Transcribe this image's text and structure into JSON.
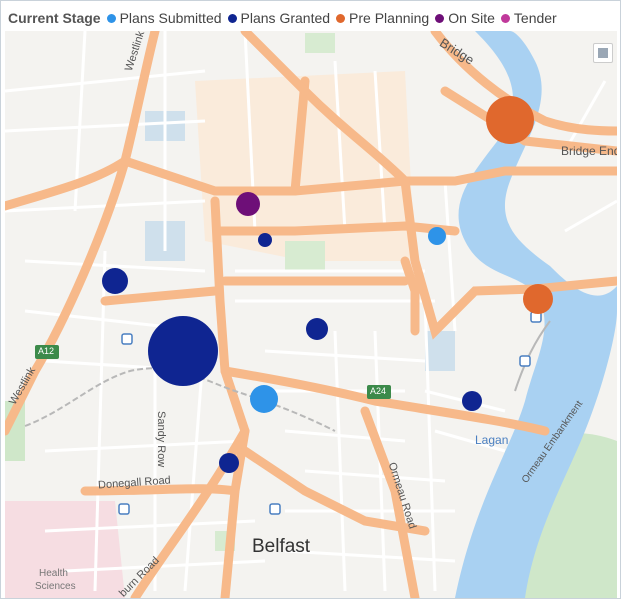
{
  "legend": {
    "title": "Current Stage",
    "entries": [
      {
        "label": "Plans Submitted",
        "color": "#2e93e8"
      },
      {
        "label": "Plans Granted",
        "color": "#0f2591"
      },
      {
        "label": "Pre Planning",
        "color": "#e0682d"
      },
      {
        "label": "On Site",
        "color": "#6e0f78"
      },
      {
        "label": "Tender",
        "color": "#c0399b"
      }
    ]
  },
  "map": {
    "labels": {
      "westlink_top": "Westlink",
      "westlink_bottom": "Westlink",
      "bridge": "Bridge",
      "bridge_end": "Bridge End",
      "a12": "A12",
      "a24": "A24",
      "sandy_row": "Sandy Row",
      "ormeau_road": "Ormeau Road",
      "donegall_road": "Donegall Road",
      "lagan": "Lagan",
      "ormeau_embankment": "Ormeau Embankment",
      "belfast": "Belfast",
      "health_sciences_line1": "Health",
      "health_sciences_line2": "Sciences",
      "lisburn_road": "burn Road"
    },
    "icons": [
      "map-layers-icon",
      "rail-station-icon"
    ]
  }
}
